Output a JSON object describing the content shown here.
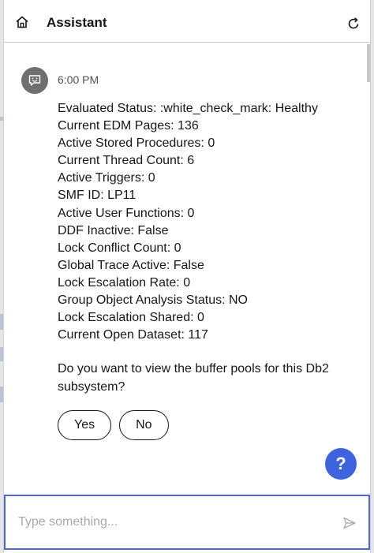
{
  "header": {
    "title": "Assistant",
    "home_icon": "home-icon",
    "refresh_icon": "refresh-icon"
  },
  "message": {
    "timestamp": "6:00 PM",
    "lines": [
      "Evaluated Status: :white_check_mark: Healthy",
      "Current EDM Pages: 136",
      "Active Stored Procedures: 0",
      "Current Thread Count: 6",
      "Active Triggers: 0",
      "SMF ID: LP11",
      "Active User Functions: 0",
      "DDF Inactive: False",
      "Lock Conflict Count: 0",
      "Global Trace Active: False",
      "Lock Escalation Rate: 0",
      "Group Object Analysis Status: NO",
      "Lock Escalation Shared: 0",
      "Current Open Dataset: 117"
    ],
    "question": "Do you want to view the buffer pools for this Db2 subsystem?",
    "options": [
      "Yes",
      "No"
    ]
  },
  "help": {
    "label": "?"
  },
  "composer": {
    "placeholder": "Type something...",
    "send_icon": "send-icon"
  },
  "colors": {
    "accent": "#3d63dd",
    "input_border": "#4a68dc",
    "avatar": "#6f6f6f"
  }
}
